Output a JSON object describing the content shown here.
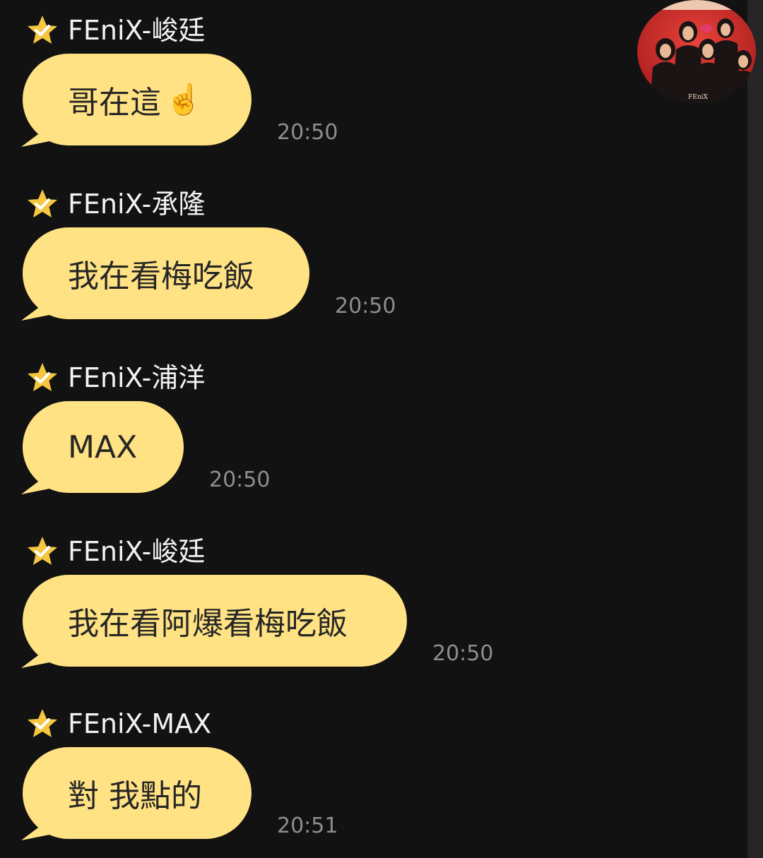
{
  "colors": {
    "background": "#121212",
    "bubble": "#ffe283",
    "bubble_text": "#262626",
    "sender_text": "#f2f2f2",
    "time_text": "#8e8e8e",
    "star": "#f6c640"
  },
  "avatar": {
    "icon": "group-avatar-photo",
    "caption": "FEniX"
  },
  "messages": [
    {
      "sender": "FEniX-峻廷",
      "text": "哥在這",
      "emoji": "☝️",
      "time": "20:50",
      "badge_icon": "star-check-icon"
    },
    {
      "sender": "FEniX-承隆",
      "text": "我在看梅吃飯",
      "emoji": "",
      "time": "20:50",
      "badge_icon": "star-check-icon"
    },
    {
      "sender": "FEniX-浦洋",
      "text": "MAX",
      "emoji": "",
      "time": "20:50",
      "badge_icon": "star-check-icon"
    },
    {
      "sender": "FEniX-峻廷",
      "text": "我在看阿爆看梅吃飯",
      "emoji": "",
      "time": "20:50",
      "badge_icon": "star-check-icon"
    },
    {
      "sender": "FEniX-MAX",
      "text": "對 我點的",
      "emoji": "",
      "time": "20:51",
      "badge_icon": "star-check-icon"
    }
  ]
}
